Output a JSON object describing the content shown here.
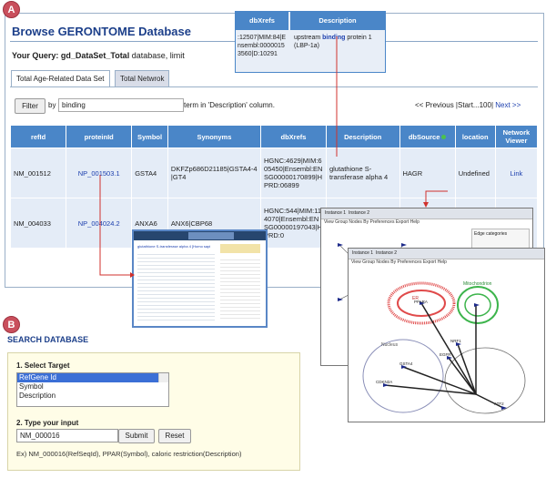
{
  "labels": {
    "a": "A",
    "b": "B"
  },
  "panelA": {
    "title": "Browse GERONTOME Database",
    "query_prefix": "Your Query: ",
    "query_value": "gd_DataSet_Total",
    "query_suffix": " database, limit",
    "tabs": [
      "Total Age-Related Data Set",
      "Total Netwrok"
    ],
    "filter_button": "Filter",
    "by_label": "by",
    "filter_value": "binding",
    "term_label": "term in 'Description' column.",
    "pager": {
      "prev": "<< Previous",
      "sep1": " |",
      "range": "Start...100",
      "sep2": "| ",
      "next": "Next >>"
    },
    "columns": [
      "refId",
      "proteinId",
      "Symbol",
      "Synonyms",
      "dbXrefs",
      "Description",
      "dbSource",
      "location",
      "Network Viewer"
    ],
    "rows": [
      {
        "refId": "NM_001512",
        "proteinId": "NP_001503.1",
        "symbol": "GSTA4",
        "synonyms": "DKFZp686D21185|GSTA4-4|GT4",
        "dbxrefs": "HGNC:4629|MIM:605450|Ensembl:ENSG00000170899|HPRD:06899",
        "description": "glutathione S-transferase alpha 4",
        "dbsource": "HAGR",
        "location": "Undefined",
        "network": "Link"
      },
      {
        "refId": "NM_004033",
        "proteinId": "NP_004024.2",
        "symbol": "ANXA6",
        "synonyms": "ANX6|CBP68",
        "dbxrefs": "HGNC:544|MIM:114070|Ensembl:ENSG00000197043|HPRD:0",
        "description": "",
        "dbsource": "",
        "location": "",
        "network": ""
      }
    ]
  },
  "callout": {
    "headers": [
      "dbXrefs",
      "Description"
    ],
    "dbxrefs_text": ":12507|MIM:84|Ensembl:00000153560|D:10291",
    "desc_before": "upstream ",
    "desc_bold": "binding",
    "desc_after": " protein 1 (LBP-1a)"
  },
  "thumb1": {
    "title": "glutathione S-transferase alpha 4 [Homo sapiens]"
  },
  "network": {
    "tabs": [
      "Instance 1",
      "Instance 2"
    ],
    "menu": "View  Group Nodes By  Preferences  Export  Help",
    "edge_categories": "Edge categories",
    "labels": {
      "er": "ER",
      "mito": "Mitochondrion",
      "nucleus": "Nucleus"
    },
    "nodes": [
      "GSTA4",
      "EGFR",
      "NRF1",
      "CDKN2A",
      "ATF2",
      "PPARA"
    ]
  },
  "panelB": {
    "title": "SEARCH DATABASE",
    "step1": "1. Select Target",
    "options": [
      "RefGene Id",
      "Symbol",
      "Description"
    ],
    "selected_index": 0,
    "step2": "2. Type your input",
    "input_value": "NM_000016",
    "submit": "Submit",
    "reset": "Reset",
    "example": "Ex) NM_000016(RefSeqId), PPAR(Symbol), caloric restriction(Description)"
  },
  "colors": {
    "accent": "#1c3f8a",
    "header_bg": "#4a86c8",
    "label_circle": "#c94f5c"
  }
}
